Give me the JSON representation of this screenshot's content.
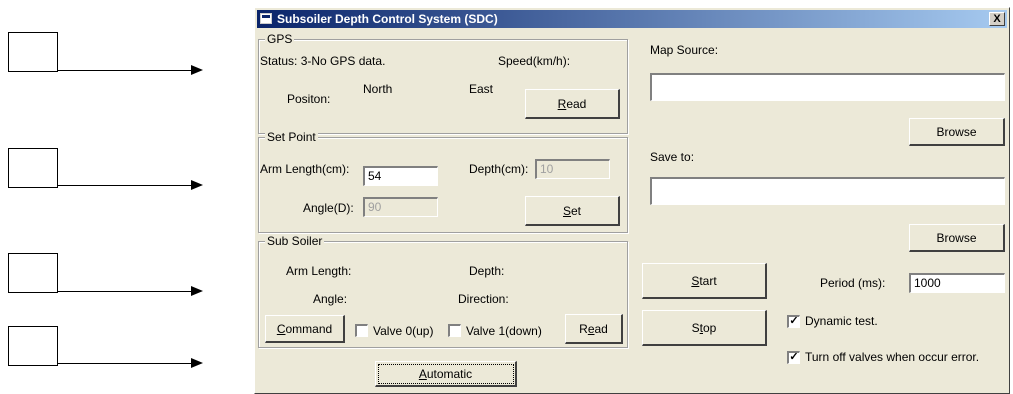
{
  "window": {
    "title": "Subsoiler Depth Control System (SDC)",
    "close_glyph": "X"
  },
  "gps": {
    "group_label": "GPS",
    "status": "Status: 3-No GPS data.",
    "speed_label": "Speed(km/h):",
    "position_label": "Positon:",
    "north_label": "North",
    "east_label": "East",
    "read_button": {
      "accel": "R",
      "rest": "ead"
    }
  },
  "set_point": {
    "group_label": "Set Point",
    "arm_length_label": "Arm Length(cm):",
    "arm_length_value": "54",
    "depth_label": "Depth(cm):",
    "depth_value": "10",
    "angle_label": "Angle(D):",
    "angle_value": "90",
    "set_button": {
      "accel": "S",
      "rest": "et"
    }
  },
  "sub_soiler": {
    "group_label": "Sub Soiler",
    "arm_length_label": "Arm Length:",
    "depth_label": "Depth:",
    "angle_label": "Angle:",
    "direction_label": "Direction:",
    "command_button": {
      "accel": "C",
      "rest": "ommand"
    },
    "valve0_label": "Valve 0(up)",
    "valve1_label": "Valve 1(down)",
    "read_button": {
      "pre": "R",
      "accel": "e",
      "rest": "ad"
    }
  },
  "automatic_button": {
    "accel": "A",
    "rest": "utomatic"
  },
  "map_source": {
    "label": "Map Source:",
    "value": "",
    "browse_label": "Browse"
  },
  "save_to": {
    "label": "Save to:",
    "value": "",
    "browse_label": "Browse"
  },
  "start_button": {
    "accel": "S",
    "rest": "tart"
  },
  "stop_button": {
    "pre": "S",
    "accel": "t",
    "rest": "op"
  },
  "period": {
    "label": "Period (ms):",
    "value": "1000"
  },
  "dynamic_test": {
    "label": "Dynamic test.",
    "checked": true,
    "glyph": "✓"
  },
  "turn_off_valves": {
    "label": "Turn off valves when occur error.",
    "checked": true,
    "glyph": "✓"
  }
}
